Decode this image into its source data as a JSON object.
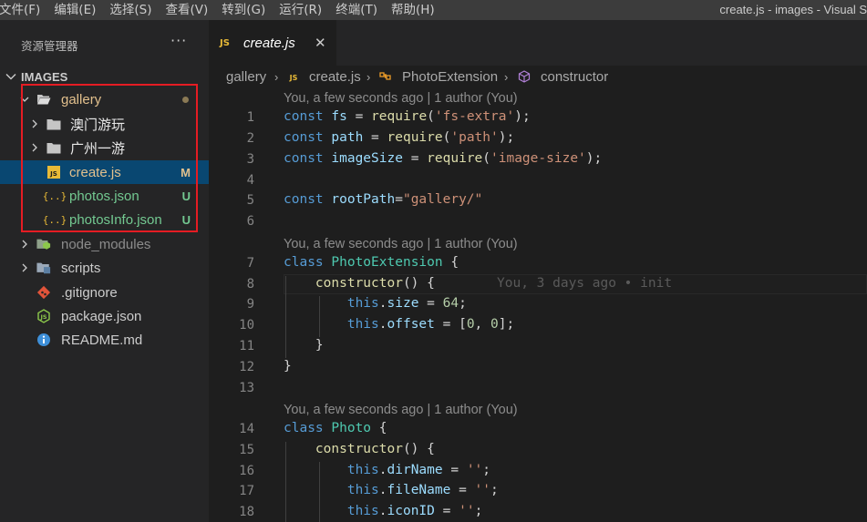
{
  "menu": [
    "文件(F)",
    "编辑(E)",
    "选择(S)",
    "查看(V)",
    "转到(G)",
    "运行(R)",
    "终端(T)",
    "帮助(H)"
  ],
  "window_title": "create.js - images - Visual S",
  "sidebar": {
    "header": "资源管理器",
    "more": "···",
    "section_title": "IMAGES",
    "items": [
      {
        "label": "gallery",
        "type": "folder-open",
        "color": "#e2c08d",
        "badge": ""
      },
      {
        "label": "澳门游玩",
        "type": "folder",
        "color": "#e8e8e8",
        "badge": ""
      },
      {
        "label": "广州一游",
        "type": "folder",
        "color": "#e8e8e8",
        "badge": ""
      },
      {
        "label": "create.js",
        "type": "js",
        "color": "#e2c08d",
        "badge": "M"
      },
      {
        "label": "photos.json",
        "type": "json",
        "color": "#73c991",
        "badge": "U"
      },
      {
        "label": "photosInfo.json",
        "type": "json",
        "color": "#73c991",
        "badge": "U"
      },
      {
        "label": "node_modules",
        "type": "node-folder",
        "color": "#8c8c8c",
        "badge": ""
      },
      {
        "label": "scripts",
        "type": "folder",
        "color": "#cccccc",
        "badge": ""
      },
      {
        "label": ".gitignore",
        "type": "git",
        "color": "#cccccc",
        "badge": ""
      },
      {
        "label": "package.json",
        "type": "npm",
        "color": "#cccccc",
        "badge": ""
      },
      {
        "label": "README.md",
        "type": "info",
        "color": "#cccccc",
        "badge": ""
      }
    ]
  },
  "tab": {
    "icon": "JS",
    "label": "create.js",
    "close": "✕"
  },
  "breadcrumb": [
    "gallery",
    "create.js",
    "PhotoExtension",
    "constructor"
  ],
  "blame": {
    "header": "You, a few seconds ago | 1 author (You)",
    "inline": "You, 3 days ago • init"
  },
  "lines": [
    "1",
    "2",
    "3",
    "4",
    "5",
    "6",
    "7",
    "8",
    "9",
    "10",
    "11",
    "12",
    "13",
    "14",
    "15",
    "16",
    "17",
    "18"
  ],
  "code": {
    "l1": {
      "kw": "const",
      "id": "fs",
      "eq": " = ",
      "fn": "require",
      "p1": "(",
      "str": "'fs-extra'",
      "p2": ");"
    },
    "l2": {
      "kw": "const",
      "id": "path",
      "eq": " = ",
      "fn": "require",
      "p1": "(",
      "str": "'path'",
      "p2": ");"
    },
    "l3": {
      "kw": "const",
      "id": "imageSize",
      "eq": " = ",
      "fn": "require",
      "p1": "(",
      "str": "'image-size'",
      "p2": ");"
    },
    "l5": {
      "kw": "const",
      "id": "rootPath",
      "eq": "=",
      "str": "\"gallery/\""
    },
    "l7": {
      "kw": "class",
      "cls": "PhotoExtension",
      "brace": " {"
    },
    "l8": {
      "fn": "constructor",
      "rest": "() {"
    },
    "l9": {
      "this": "this",
      "dot": ".",
      "prop": "size",
      "eq": " = ",
      "num": "64",
      "end": ";"
    },
    "l10": {
      "this": "this",
      "dot": ".",
      "prop": "offset",
      "eq": " = [",
      "n1": "0",
      "comma": ", ",
      "n2": "0",
      "end": "];"
    },
    "l11": "}",
    "l12": "}",
    "l14": {
      "kw": "class",
      "cls": "Photo",
      "brace": " {"
    },
    "l15": {
      "fn": "constructor",
      "rest": "() {"
    },
    "l16": {
      "this": "this",
      "dot": ".",
      "prop": "dirName",
      "eq": " = ",
      "str": "''",
      "end": ";"
    },
    "l17": {
      "this": "this",
      "dot": ".",
      "prop": "fileName",
      "eq": " = ",
      "str": "''",
      "end": ";"
    },
    "l18": {
      "this": "this",
      "dot": ".",
      "prop": "iconID",
      "eq": " = ",
      "str": "''",
      "end": ";"
    }
  }
}
